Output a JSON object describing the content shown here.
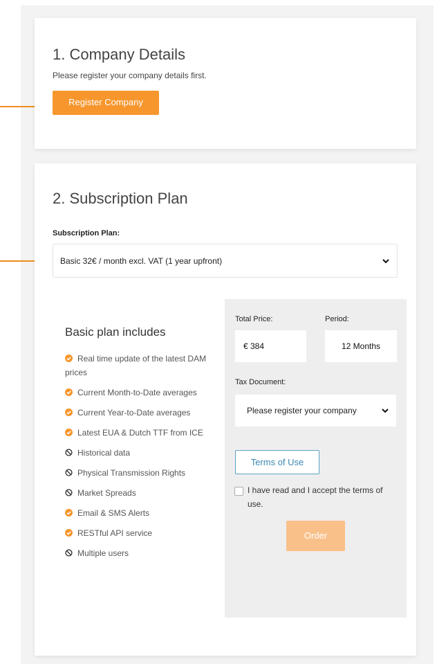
{
  "company": {
    "heading": "1. Company Details",
    "description": "Please register your company details first.",
    "register_button": "Register Company"
  },
  "subscription": {
    "heading": "2. Subscription Plan",
    "plan_label": "Subscription Plan:",
    "plan_selected": "Basic 32€ / month excl. VAT (1 year upfront)"
  },
  "plan_features": {
    "title": "Basic plan includes",
    "items": [
      {
        "label": "Real time update of the latest DAM prices",
        "included": true
      },
      {
        "label": "Current Month-to-Date averages",
        "included": true
      },
      {
        "label": "Current Year-to-Date averages",
        "included": true
      },
      {
        "label": "Latest EUA & Dutch TTF from ICE",
        "included": true
      },
      {
        "label": "Historical data",
        "included": false
      },
      {
        "label": "Physical Transmission Rights",
        "included": false
      },
      {
        "label": "Market Spreads",
        "included": false
      },
      {
        "label": "Email & SMS Alerts",
        "included": true
      },
      {
        "label": "RESTful API service",
        "included": true
      },
      {
        "label": "Multiple users",
        "included": false
      }
    ]
  },
  "order": {
    "total_price_label": "Total Price:",
    "total_price_value": "€ 384",
    "period_label": "Period:",
    "period_value": "12 Months",
    "tax_document_label": "Tax Document:",
    "tax_document_selected": "Please register your company",
    "terms_button": "Terms of Use",
    "accept_terms_label": "I have read and I accept the terms of use.",
    "accept_terms_checked": false,
    "order_button": "Order"
  },
  "colors": {
    "accent_orange": "#f7962d",
    "accent_orange_disabled": "#f9c08a",
    "arrow": "#f08c1e",
    "link_blue": "#3a88b0"
  }
}
